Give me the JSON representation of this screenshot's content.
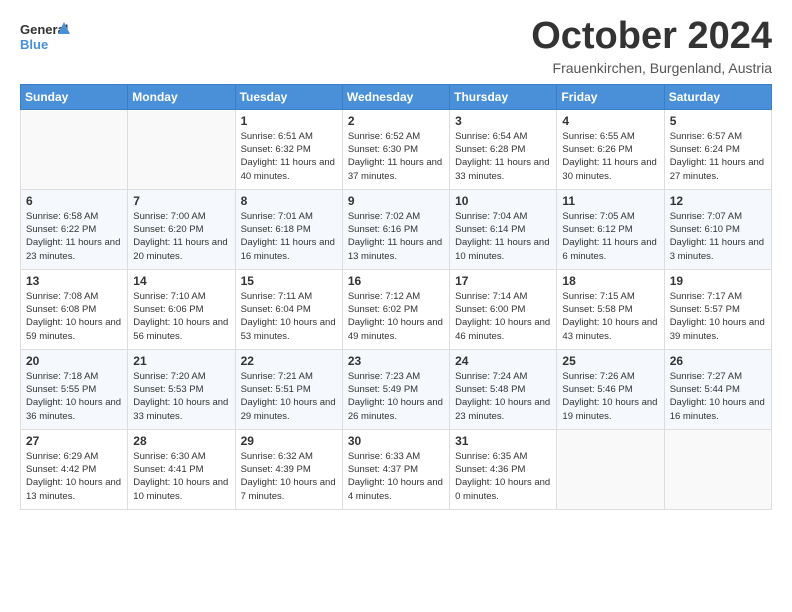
{
  "header": {
    "logo_general": "General",
    "logo_blue": "Blue",
    "month": "October 2024",
    "location": "Frauenkirchen, Burgenland, Austria"
  },
  "weekdays": [
    "Sunday",
    "Monday",
    "Tuesday",
    "Wednesday",
    "Thursday",
    "Friday",
    "Saturday"
  ],
  "weeks": [
    [
      {
        "day": "",
        "info": ""
      },
      {
        "day": "",
        "info": ""
      },
      {
        "day": "1",
        "info": "Sunrise: 6:51 AM\nSunset: 6:32 PM\nDaylight: 11 hours and 40 minutes."
      },
      {
        "day": "2",
        "info": "Sunrise: 6:52 AM\nSunset: 6:30 PM\nDaylight: 11 hours and 37 minutes."
      },
      {
        "day": "3",
        "info": "Sunrise: 6:54 AM\nSunset: 6:28 PM\nDaylight: 11 hours and 33 minutes."
      },
      {
        "day": "4",
        "info": "Sunrise: 6:55 AM\nSunset: 6:26 PM\nDaylight: 11 hours and 30 minutes."
      },
      {
        "day": "5",
        "info": "Sunrise: 6:57 AM\nSunset: 6:24 PM\nDaylight: 11 hours and 27 minutes."
      }
    ],
    [
      {
        "day": "6",
        "info": "Sunrise: 6:58 AM\nSunset: 6:22 PM\nDaylight: 11 hours and 23 minutes."
      },
      {
        "day": "7",
        "info": "Sunrise: 7:00 AM\nSunset: 6:20 PM\nDaylight: 11 hours and 20 minutes."
      },
      {
        "day": "8",
        "info": "Sunrise: 7:01 AM\nSunset: 6:18 PM\nDaylight: 11 hours and 16 minutes."
      },
      {
        "day": "9",
        "info": "Sunrise: 7:02 AM\nSunset: 6:16 PM\nDaylight: 11 hours and 13 minutes."
      },
      {
        "day": "10",
        "info": "Sunrise: 7:04 AM\nSunset: 6:14 PM\nDaylight: 11 hours and 10 minutes."
      },
      {
        "day": "11",
        "info": "Sunrise: 7:05 AM\nSunset: 6:12 PM\nDaylight: 11 hours and 6 minutes."
      },
      {
        "day": "12",
        "info": "Sunrise: 7:07 AM\nSunset: 6:10 PM\nDaylight: 11 hours and 3 minutes."
      }
    ],
    [
      {
        "day": "13",
        "info": "Sunrise: 7:08 AM\nSunset: 6:08 PM\nDaylight: 10 hours and 59 minutes."
      },
      {
        "day": "14",
        "info": "Sunrise: 7:10 AM\nSunset: 6:06 PM\nDaylight: 10 hours and 56 minutes."
      },
      {
        "day": "15",
        "info": "Sunrise: 7:11 AM\nSunset: 6:04 PM\nDaylight: 10 hours and 53 minutes."
      },
      {
        "day": "16",
        "info": "Sunrise: 7:12 AM\nSunset: 6:02 PM\nDaylight: 10 hours and 49 minutes."
      },
      {
        "day": "17",
        "info": "Sunrise: 7:14 AM\nSunset: 6:00 PM\nDaylight: 10 hours and 46 minutes."
      },
      {
        "day": "18",
        "info": "Sunrise: 7:15 AM\nSunset: 5:58 PM\nDaylight: 10 hours and 43 minutes."
      },
      {
        "day": "19",
        "info": "Sunrise: 7:17 AM\nSunset: 5:57 PM\nDaylight: 10 hours and 39 minutes."
      }
    ],
    [
      {
        "day": "20",
        "info": "Sunrise: 7:18 AM\nSunset: 5:55 PM\nDaylight: 10 hours and 36 minutes."
      },
      {
        "day": "21",
        "info": "Sunrise: 7:20 AM\nSunset: 5:53 PM\nDaylight: 10 hours and 33 minutes."
      },
      {
        "day": "22",
        "info": "Sunrise: 7:21 AM\nSunset: 5:51 PM\nDaylight: 10 hours and 29 minutes."
      },
      {
        "day": "23",
        "info": "Sunrise: 7:23 AM\nSunset: 5:49 PM\nDaylight: 10 hours and 26 minutes."
      },
      {
        "day": "24",
        "info": "Sunrise: 7:24 AM\nSunset: 5:48 PM\nDaylight: 10 hours and 23 minutes."
      },
      {
        "day": "25",
        "info": "Sunrise: 7:26 AM\nSunset: 5:46 PM\nDaylight: 10 hours and 19 minutes."
      },
      {
        "day": "26",
        "info": "Sunrise: 7:27 AM\nSunset: 5:44 PM\nDaylight: 10 hours and 16 minutes."
      }
    ],
    [
      {
        "day": "27",
        "info": "Sunrise: 6:29 AM\nSunset: 4:42 PM\nDaylight: 10 hours and 13 minutes."
      },
      {
        "day": "28",
        "info": "Sunrise: 6:30 AM\nSunset: 4:41 PM\nDaylight: 10 hours and 10 minutes."
      },
      {
        "day": "29",
        "info": "Sunrise: 6:32 AM\nSunset: 4:39 PM\nDaylight: 10 hours and 7 minutes."
      },
      {
        "day": "30",
        "info": "Sunrise: 6:33 AM\nSunset: 4:37 PM\nDaylight: 10 hours and 4 minutes."
      },
      {
        "day": "31",
        "info": "Sunrise: 6:35 AM\nSunset: 4:36 PM\nDaylight: 10 hours and 0 minutes."
      },
      {
        "day": "",
        "info": ""
      },
      {
        "day": "",
        "info": ""
      }
    ]
  ]
}
